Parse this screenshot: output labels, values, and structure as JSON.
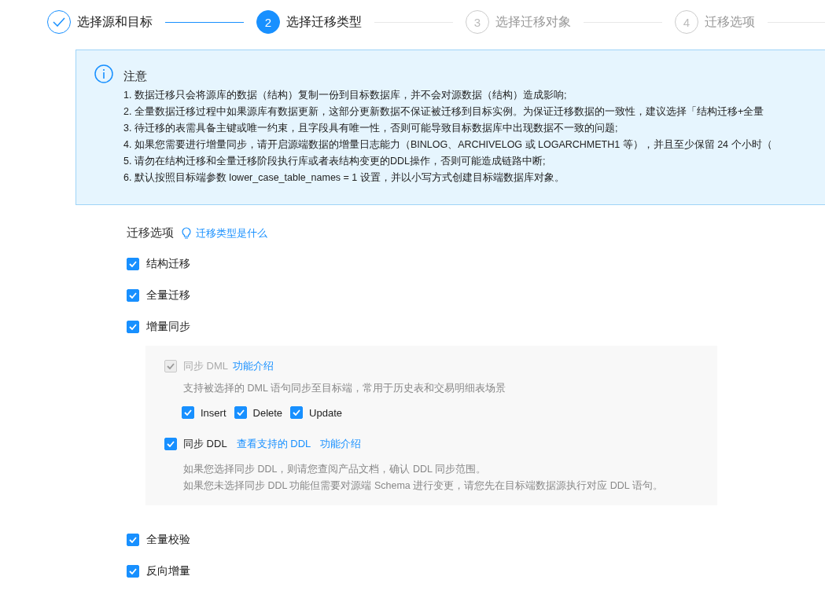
{
  "steps": [
    {
      "label": "选择源和目标",
      "completed": true,
      "selected": false
    },
    {
      "number": "2",
      "label": "选择迁移类型",
      "completed": false,
      "selected": true
    },
    {
      "number": "3",
      "label": "选择迁移对象",
      "completed": false,
      "selected": false
    },
    {
      "number": "4",
      "label": "迁移选项",
      "completed": false,
      "selected": false
    }
  ],
  "notice": {
    "title": "注意",
    "lines": [
      "1. 数据迁移只会将源库的数据（结构）复制一份到目标数据库，并不会对源数据（结构）造成影响;",
      "2. 全量数据迁移过程中如果源库有数据更新，这部分更新数据不保证被迁移到目标实例。为保证迁移数据的一致性，建议选择「结构迁移+全量",
      "3. 待迁移的表需具备主键或唯一约束，且字段具有唯一性，否则可能导致目标数据库中出现数据不一致的问题;",
      "4. 如果您需要进行增量同步，请开启源端数据的增量日志能力（BINLOG、ARCHIVELOG 或 LOGARCHMETH1 等），并且至少保留 24 个小时（",
      "5. 请勿在结构迁移和全量迁移阶段执行库或者表结构变更的DDL操作，否则可能造成链路中断;",
      "6. 默认按照目标端参数 lower_case_table_names = 1 设置，并以小写方式创建目标端数据库对象。"
    ]
  },
  "options": {
    "title": "迁移选项",
    "help_link": "迁移类型是什么",
    "items_before": [
      {
        "label": "结构迁移",
        "checked": true
      },
      {
        "label": "全量迁移",
        "checked": true
      },
      {
        "label": "增量同步",
        "checked": true
      }
    ],
    "sync_panel": {
      "dml": {
        "label": "同步 DML",
        "checked": true,
        "disabled": true,
        "link": "功能介绍",
        "description": "支持被选择的 DML 语句同步至目标端，常用于历史表和交易明细表场景",
        "types": [
          {
            "label": "Insert",
            "checked": true
          },
          {
            "label": "Delete",
            "checked": true
          },
          {
            "label": "Update",
            "checked": true
          }
        ]
      },
      "ddl": {
        "label": "同步 DDL",
        "checked": true,
        "disabled": false,
        "links": [
          "查看支持的 DDL",
          "功能介绍"
        ],
        "notes": [
          "如果您选择同步 DDL，则请您查阅产品文档，确认 DDL 同步范围。",
          "如果您未选择同步 DDL 功能但需要对源端 Schema 进行变更，请您先在目标端数据源执行对应 DDL 语句。"
        ]
      }
    },
    "items_after": [
      {
        "label": "全量校验",
        "checked": true
      },
      {
        "label": "反向增量",
        "checked": true
      }
    ]
  }
}
